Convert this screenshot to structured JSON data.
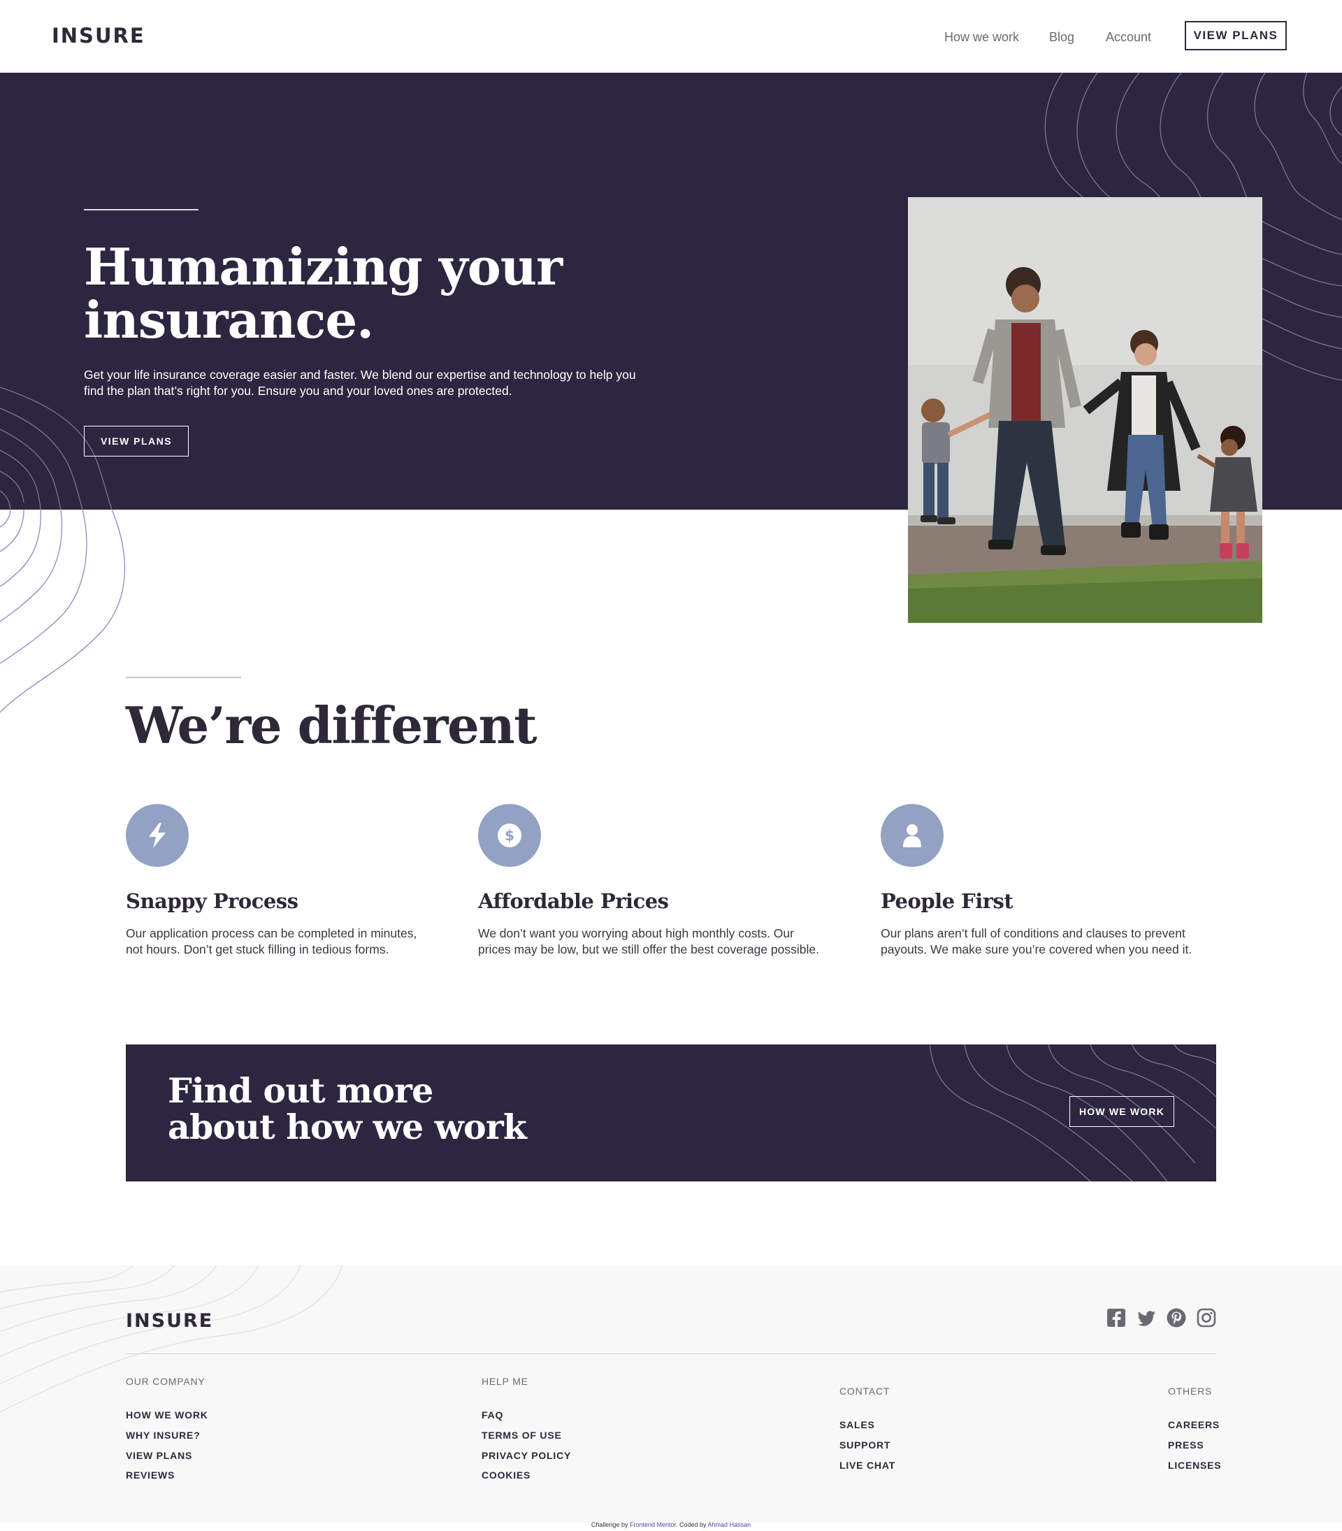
{
  "header": {
    "logo": "INSURE",
    "nav": [
      "How we work",
      "Blog",
      "Account"
    ],
    "cta": "VIEW PLANS"
  },
  "hero": {
    "title_line1": "Humanizing your",
    "title_line2": "insurance.",
    "text_line1": "Get your life insurance coverage easier and faster. We blend our expertise and technology to help you",
    "text_line2": "find the plan that’s right for you. Ensure you and your loved ones are protected.",
    "button": "VIEW PLANS"
  },
  "different": {
    "title": "We’re different",
    "features": [
      {
        "icon": "lightning-icon",
        "title": "Snappy Process",
        "line1": "Our application process can be completed in minutes,",
        "line2": "not hours. Don’t get stuck filling in tedious forms."
      },
      {
        "icon": "dollar-icon",
        "title": "Affordable Prices",
        "line1": "We don’t want you worrying about high monthly costs. Our",
        "line2": "prices may be low, but we still offer the best coverage possible."
      },
      {
        "icon": "person-icon",
        "title": "People First",
        "line1": "Our plans aren’t full of conditions and clauses to prevent",
        "line2": "payouts. We make sure you’re covered when you need it."
      }
    ]
  },
  "cta_banner": {
    "title_line1": "Find out more",
    "title_line2": "about how we work",
    "button": "HOW WE WORK"
  },
  "footer": {
    "logo": "INSURE",
    "social": [
      "facebook-icon",
      "twitter-icon",
      "pinterest-icon",
      "instagram-icon"
    ],
    "columns": [
      {
        "heading": "OUR COMPANY",
        "links": [
          "HOW WE WORK",
          "WHY INSURE?",
          "VIEW PLANS",
          "REVIEWS"
        ]
      },
      {
        "heading": "HELP ME",
        "links": [
          "FAQ",
          "TERMS OF USE",
          "PRIVACY POLICY",
          "COOKIES"
        ]
      },
      {
        "heading": "CONTACT",
        "links": [
          "SALES",
          "SUPPORT",
          "LIVE CHAT"
        ]
      },
      {
        "heading": "OTHERS",
        "links": [
          "CAREERS",
          "PRESS",
          "LICENSES"
        ]
      }
    ],
    "credit": {
      "prefix": "Challenge by ",
      "fm": "Frontend Mentor",
      "mid": ". Coded by ",
      "author": "Ahmad Hassan"
    }
  },
  "colors": {
    "dark_violet": "#2c2640",
    "icon_blue": "#93a2c2",
    "footer_bg": "#f8f8f9"
  }
}
